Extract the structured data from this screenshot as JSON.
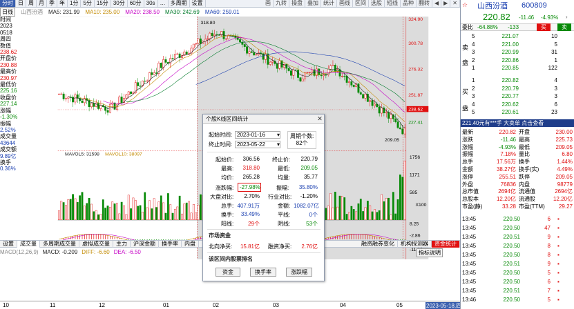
{
  "toolbar": {
    "items": [
      "分时",
      "日",
      "周",
      "月",
      "季",
      "年",
      "1分",
      "5分",
      "15分",
      "30分",
      "60分",
      "30s",
      "…",
      "多周期",
      "设置"
    ],
    "icons": [
      "画",
      "九转",
      "操盘",
      "叠加",
      "统计",
      "画线",
      "区间",
      "选股",
      "短线",
      "品种",
      "翻转",
      "◀",
      "▶",
      "✕"
    ]
  },
  "ma_row": {
    "mode": "日线",
    "stock": "山西汾酒",
    "ma5": "MA5: 231.99",
    "ma10": "MA10: 235.00",
    "ma20": "MA20: 238.50",
    "ma30": "MA30: 242.69",
    "ma60": "MA60: 259.01"
  },
  "left_panel": {
    "time_label": "时间",
    "time_year": "2023",
    "time_date": "0518",
    "weekday": "周四",
    "value_label": "数值",
    "value": "238.62",
    "open_label": "开盘价",
    "open": "230.88",
    "high_label": "最高价",
    "high": "230.97",
    "low_label": "最低价",
    "low": "225.16",
    "close_label": "收盘价",
    "close": "227.14",
    "change_label": "涨幅",
    "change": "-1.30%",
    "amp_label": "振幅",
    "amp": "2.52%",
    "vol_label": "成交量",
    "vol": "43644",
    "amount_label": "成交额",
    "amount": "9.89亿",
    "turnover_label": "换手",
    "turnover": "0.36%"
  },
  "chart_annotations": {
    "high_label": "318.80",
    "low_label": "209.05",
    "cursor_value": "238.62"
  },
  "price_axis": [
    "324.90",
    "300.78",
    "276.32",
    "251.87",
    "238.62",
    "227.41"
  ],
  "vol_axis": [
    "1756",
    "1171",
    "585"
  ],
  "macd_axis": [
    "8.25",
    "-2.86",
    "-11.16"
  ],
  "vol_row": {
    "ma5": "MAVOL5: 31598",
    "ma10": "MAVOL10: 38097"
  },
  "macd_row": {
    "title": "MACD(12,26,9)",
    "macd": "MACD: -0.209",
    "diff": "DIFF: -6.60",
    "dea": "DEA: -6.50"
  },
  "bottom_tabs": [
    "设置",
    "成交量",
    "多周期成交量",
    "虚拟成交量",
    "主力",
    "沪深金额",
    "换手率",
    "内盘",
    "...",
    "",
    "",
    "...",
    "融资融券变化",
    "机构探测器",
    "资金",
    "指标说明"
  ],
  "bottom_tabs_visible": [
    "设置",
    "成交量",
    "多周期成交量",
    "虚拟成交量",
    "主力",
    "沪深金额",
    "换手率",
    "内盘"
  ],
  "bottom_tabs_right": [
    "融资融券变化",
    "机构探测器",
    "资金统计"
  ],
  "indicator_help": "指标说明",
  "x100": "X100",
  "time_axis": [
    "10",
    "11",
    "12",
    "01",
    "02",
    "03",
    "04",
    "05",
    "2023-05-18,四"
  ],
  "dialog": {
    "title": "个股K线区间统计",
    "start_label": "起始时间:",
    "start_date": "2023-01-16",
    "end_label": "终止时间:",
    "end_date": "2023-05-22",
    "period_label": "周期个数:",
    "period_count": "82个",
    "start_price_label": "起始价:",
    "start_price": "306.56",
    "end_price_label": "终止价:",
    "end_price": "220.79",
    "high_label": "最高:",
    "high": "318.80",
    "low_label": "最低:",
    "low": "209.05",
    "avg_label": "均价:",
    "avg": "265.28",
    "avg_vol_label": "均量:",
    "avg_vol": "35.77",
    "change_label": "涨跌幅:",
    "change": "-27.98%",
    "amp_label": "振幅:",
    "amp": "35.80%",
    "market_label": "大盘对比:",
    "market": "2.70%",
    "industry_label": "行业对比:",
    "industry": "-1.20%",
    "total_hand_label": "总手:",
    "total_hand": "407.91万",
    "amount_label": "金额:",
    "amount": "1082.07亿",
    "turnover_label": "换手:",
    "turnover": "33.49%",
    "flat_label": "平线:",
    "flat": "0个",
    "up_label": "阳线:",
    "up": "29个",
    "down_label": "阴线:",
    "down": "53个",
    "fund_section": "市场资金",
    "north_label": "北向净买:",
    "north": "15.81亿",
    "margin_label": "融资净买:",
    "margin": "2.76亿",
    "rank_section": "该区间内股票排名",
    "btn_funds": "资金",
    "btn_turnover": "换手率",
    "btn_change": "涨跌幅"
  },
  "right_panel": {
    "name": "山西汾酒",
    "code": "600809",
    "price": "220.82",
    "change": "-11.46",
    "pct": "-4.93%",
    "weibi_label": "委比",
    "weibi": "-64.88%",
    "weicha": "-133",
    "sell_tag": "买",
    "sell_buy": "卖",
    "sell_label": "卖",
    "pan_label": "盘",
    "buy_label": "买",
    "buy_pan": "盘",
    "asks": [
      {
        "lvl": "5",
        "price": "221.07",
        "vol": "10"
      },
      {
        "lvl": "4",
        "price": "221.00",
        "vol": "5"
      },
      {
        "lvl": "3",
        "price": "220.99",
        "vol": "31"
      },
      {
        "lvl": "2",
        "price": "220.86",
        "vol": "1"
      },
      {
        "lvl": "1",
        "price": "220.85",
        "vol": "122"
      }
    ],
    "bids": [
      {
        "lvl": "1",
        "price": "220.82",
        "vol": "4"
      },
      {
        "lvl": "2",
        "price": "220.79",
        "vol": "3"
      },
      {
        "lvl": "3",
        "price": "220.77",
        "vol": "3"
      },
      {
        "lvl": "4",
        "price": "220.62",
        "vol": "6"
      },
      {
        "lvl": "5",
        "price": "220.61",
        "vol": "23"
      }
    ],
    "banner": "221.40元有***手 大卖单 点击查看",
    "stats": [
      [
        "最新",
        "220.82",
        "开盘",
        "230.00"
      ],
      [
        "涨跌",
        "-11.46",
        "最高",
        "225.73"
      ],
      [
        "涨幅",
        "-4.93%",
        "最低",
        "209.05"
      ],
      [
        "振幅",
        "7.18%",
        "量比",
        "6.80"
      ],
      [
        "总手",
        "17.56万",
        "换手",
        "1.44%"
      ],
      [
        "金额",
        "38.27亿",
        "换手(实)",
        "4.49%"
      ],
      [
        "涨停",
        "255.51",
        "跌停",
        "209.05"
      ],
      [
        "外盘",
        "76836",
        "内盘",
        "98779"
      ],
      [
        "总市值",
        "2694亿",
        "流通值",
        "2694亿"
      ],
      [
        "总股本",
        "12.20亿",
        "流通股",
        "12.20亿"
      ],
      [
        "市盈(静)",
        "33.28",
        "市盈(TTM)",
        "29.27"
      ]
    ],
    "ticks": [
      {
        "t": "13:45",
        "p": "220.50",
        "v": "6",
        "d": "red"
      },
      {
        "t": "13:45",
        "p": "220.50",
        "v": "47",
        "d": "red"
      },
      {
        "t": "13:45",
        "p": "220.51",
        "v": "9",
        "d": "red"
      },
      {
        "t": "13:45",
        "p": "220.50",
        "v": "8",
        "d": "red"
      },
      {
        "t": "13:45",
        "p": "220.50",
        "v": "8",
        "d": "red"
      },
      {
        "t": "13:45",
        "p": "220.51",
        "v": "9",
        "d": "red"
      },
      {
        "t": "13:45",
        "p": "220.50",
        "v": "5",
        "d": "red"
      },
      {
        "t": "13:45",
        "p": "220.50",
        "v": "6",
        "d": "red"
      },
      {
        "t": "13:45",
        "p": "220.51",
        "v": "7",
        "d": "red"
      },
      {
        "t": "13:46",
        "p": "220.50",
        "v": "5",
        "d": "red"
      }
    ]
  },
  "colors": {
    "up": "#e01010",
    "down": "#078a07",
    "selection": "#d8d8d8",
    "accent": "#3a5fae"
  }
}
